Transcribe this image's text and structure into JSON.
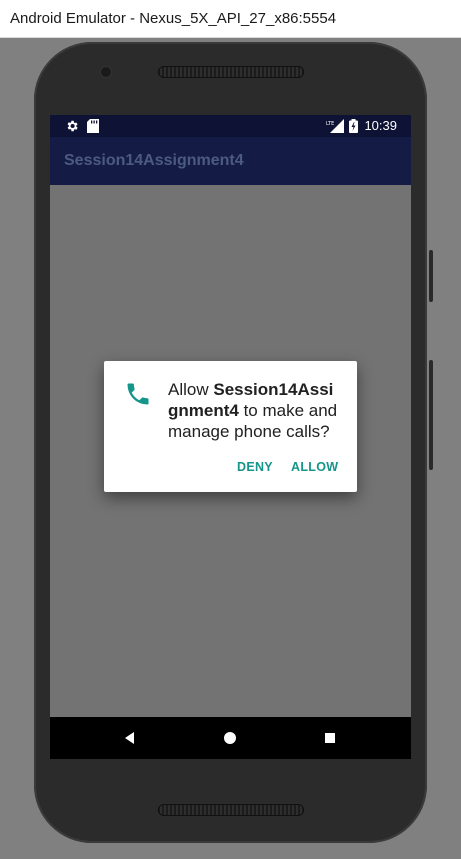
{
  "window": {
    "title": "Android Emulator - Nexus_5X_API_27_x86:5554"
  },
  "status_bar": {
    "time": "10:39",
    "left_icons": [
      "settings-icon",
      "sd-card-icon"
    ],
    "right_icons": [
      "lte-signal-icon",
      "battery-icon"
    ]
  },
  "app_bar": {
    "title": "Session14Assignment4"
  },
  "dialog": {
    "message_prefix": "Allow ",
    "app_name": "Session14Assi gnment4",
    "message_suffix": " to make and manage phone calls?",
    "icon": "phone-icon",
    "deny_label": "DENY",
    "allow_label": "ALLOW"
  },
  "nav_bar": {
    "buttons": [
      "back-icon",
      "home-icon",
      "recents-icon"
    ]
  },
  "colors": {
    "status_bar": "#0e1235",
    "app_bar": "#141c45",
    "accent": "#16958a",
    "scrim": "#737373"
  }
}
